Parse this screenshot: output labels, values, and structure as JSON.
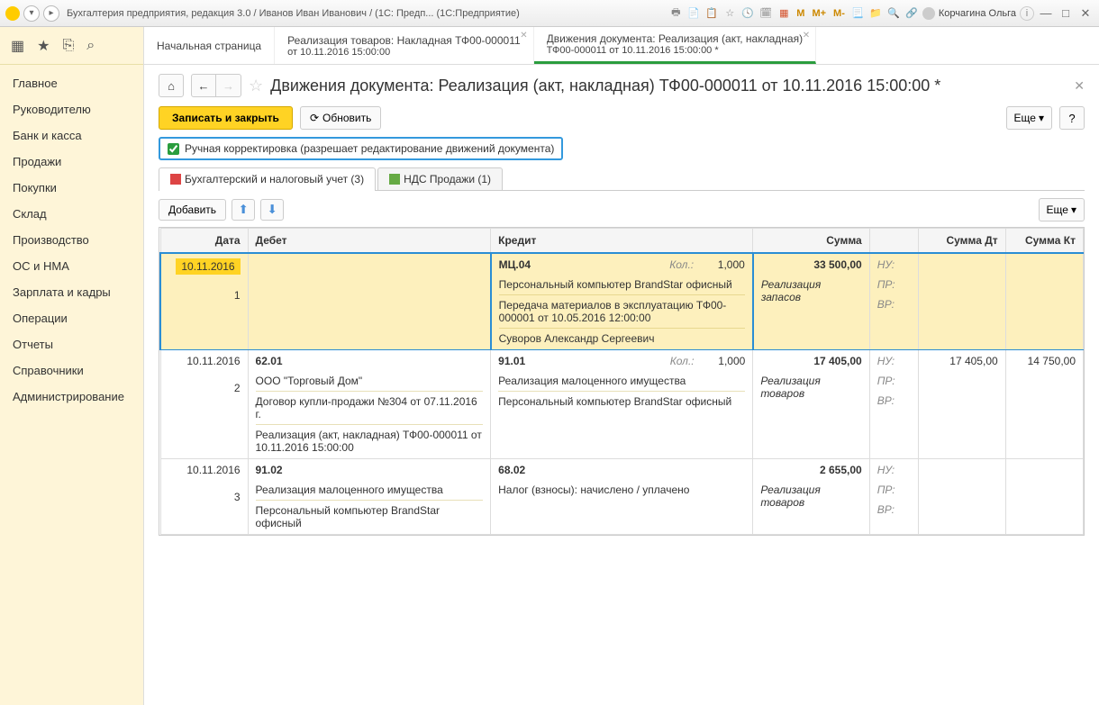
{
  "titlebar": {
    "title": "Бухгалтерия предприятия, редакция 3.0 / Иванов Иван Иванович / (1С: Предп...  (1С:Предприятие)",
    "m_buttons": [
      "M",
      "M+",
      "M-"
    ],
    "user": "Корчагина Ольга"
  },
  "leftMenu": [
    "Главное",
    "Руководителю",
    "Банк и касса",
    "Продажи",
    "Покупки",
    "Склад",
    "Производство",
    "ОС и НМА",
    "Зарплата и кадры",
    "Операции",
    "Отчеты",
    "Справочники",
    "Администрирование"
  ],
  "tabs": [
    {
      "line1": "Начальная страница",
      "line2": ""
    },
    {
      "line1": "Реализация товаров: Накладная ТФ00-000011",
      "line2": "от 10.11.2016 15:00:00"
    },
    {
      "line1": "Движения документа: Реализация (акт, накладная)",
      "line2": "ТФ00-000011 от 10.11.2016 15:00:00 *",
      "active": true
    }
  ],
  "pageTitle": "Движения документа: Реализация (акт, накладная) ТФ00-000011 от 10.11.2016 15:00:00 *",
  "buttons": {
    "save": "Записать и закрыть",
    "refresh": "Обновить",
    "more": "Еще",
    "add": "Добавить"
  },
  "checkbox": {
    "label": "Ручная корректировка (разрешает редактирование движений документа)"
  },
  "innerTabs": [
    {
      "label": "Бухгалтерский и налоговый учет (3)",
      "active": true
    },
    {
      "label": "НДС Продажи (1)"
    }
  ],
  "tableHeaders": {
    "date": "Дата",
    "debit": "Дебет",
    "credit": "Кредит",
    "sum": "Сумма",
    "sumdt": "Сумма Дт",
    "sumkt": "Сумма Кт"
  },
  "tags": {
    "nu": "НУ:",
    "pr": "ПР:",
    "vr": "ВР:",
    "kol": "Кол.:"
  },
  "rows": [
    {
      "selected": true,
      "date": "10.11.2016",
      "num": "1",
      "debit_acct": "",
      "debit_lines": [],
      "credit_acct": "МЦ.04",
      "credit_kol": "1,000",
      "credit_lines": [
        "Персональный компьютер BrandStar офисный",
        "Передача материалов в эксплуатацию ТФ00-000001 от 10.05.2016 12:00:00",
        "Суворов Александр Сергеевич"
      ],
      "sum": "33 500,00",
      "sum_note": "Реализация запасов",
      "sumdt": "",
      "sumkt": ""
    },
    {
      "date": "10.11.2016",
      "num": "2",
      "debit_acct": "62.01",
      "debit_lines": [
        "ООО \"Торговый Дом\"",
        "Договор купли-продажи №304 от 07.11.2016 г.",
        "Реализация (акт, накладная) ТФ00-000011 от 10.11.2016 15:00:00"
      ],
      "credit_acct": "91.01",
      "credit_kol": "1,000",
      "credit_lines": [
        "Реализация малоценного имущества",
        "Персональный компьютер BrandStar офисный"
      ],
      "sum": "17 405,00",
      "sum_note": "Реализация товаров",
      "sumdt": "17 405,00",
      "sumkt": "14 750,00"
    },
    {
      "date": "10.11.2016",
      "num": "3",
      "debit_acct": "91.02",
      "debit_lines": [
        "Реализация малоценного имущества",
        "Персональный компьютер BrandStar офисный"
      ],
      "credit_acct": "68.02",
      "credit_kol": "",
      "credit_lines": [
        "Налог (взносы): начислено / уплачено"
      ],
      "sum": "2 655,00",
      "sum_note": "Реализация товаров",
      "sumdt": "",
      "sumkt": ""
    }
  ]
}
